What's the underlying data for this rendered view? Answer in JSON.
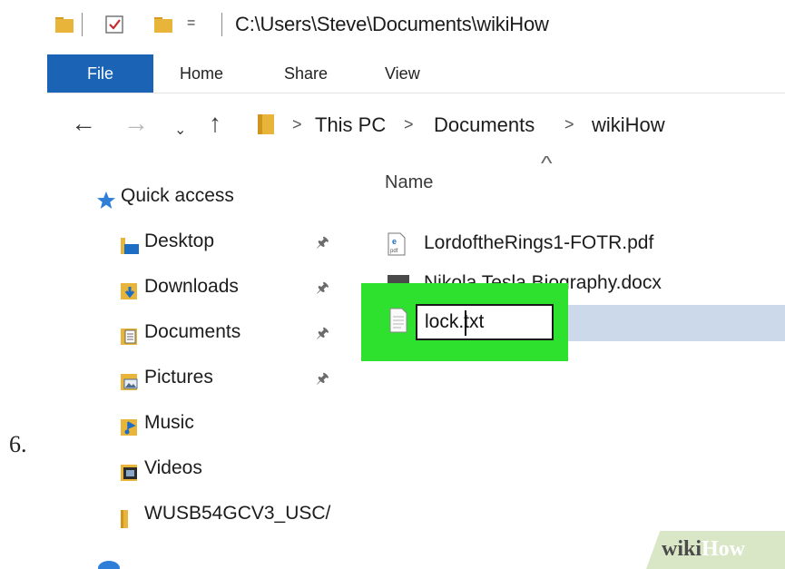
{
  "step_number": "6.",
  "title_bar": {
    "path": "C:\\Users\\Steve\\Documents\\wikiHow",
    "dropdown_glyph": "="
  },
  "ribbon": {
    "tabs": [
      "File",
      "Home",
      "Share",
      "View"
    ]
  },
  "address_bar": {
    "breadcrumbs": [
      "This PC",
      "Documents",
      "wikiHow"
    ],
    "separator": ">"
  },
  "sidebar": {
    "quick_access_label": "Quick access",
    "items": [
      {
        "label": "Desktop",
        "icon": "desktop-folder-icon",
        "pinned": true
      },
      {
        "label": "Downloads",
        "icon": "downloads-folder-icon",
        "pinned": true
      },
      {
        "label": "Documents",
        "icon": "documents-folder-icon",
        "pinned": true
      },
      {
        "label": "Pictures",
        "icon": "pictures-folder-icon",
        "pinned": true
      },
      {
        "label": "Music",
        "icon": "music-folder-icon",
        "pinned": false
      },
      {
        "label": "Videos",
        "icon": "videos-folder-icon",
        "pinned": false
      },
      {
        "label": "WUSB54GCV3_USC/",
        "icon": "folder-icon",
        "pinned": false
      }
    ]
  },
  "file_list": {
    "column_header": "Name",
    "files": [
      {
        "name": "LordoftheRings1-FOTR.pdf",
        "icon": "pdf-file-icon"
      },
      {
        "name": "Nikola Tesla Biography.docx",
        "icon": "docx-file-icon"
      }
    ],
    "renaming": {
      "value": "lock.txt",
      "icon": "text-file-icon"
    }
  },
  "watermark": {
    "wiki": "wiki",
    "how": "How"
  },
  "colors": {
    "file_tab": "#1a63b5",
    "selection": "#cbd9ea",
    "highlight": "#2ee12e",
    "folder": "#e8b43a"
  }
}
